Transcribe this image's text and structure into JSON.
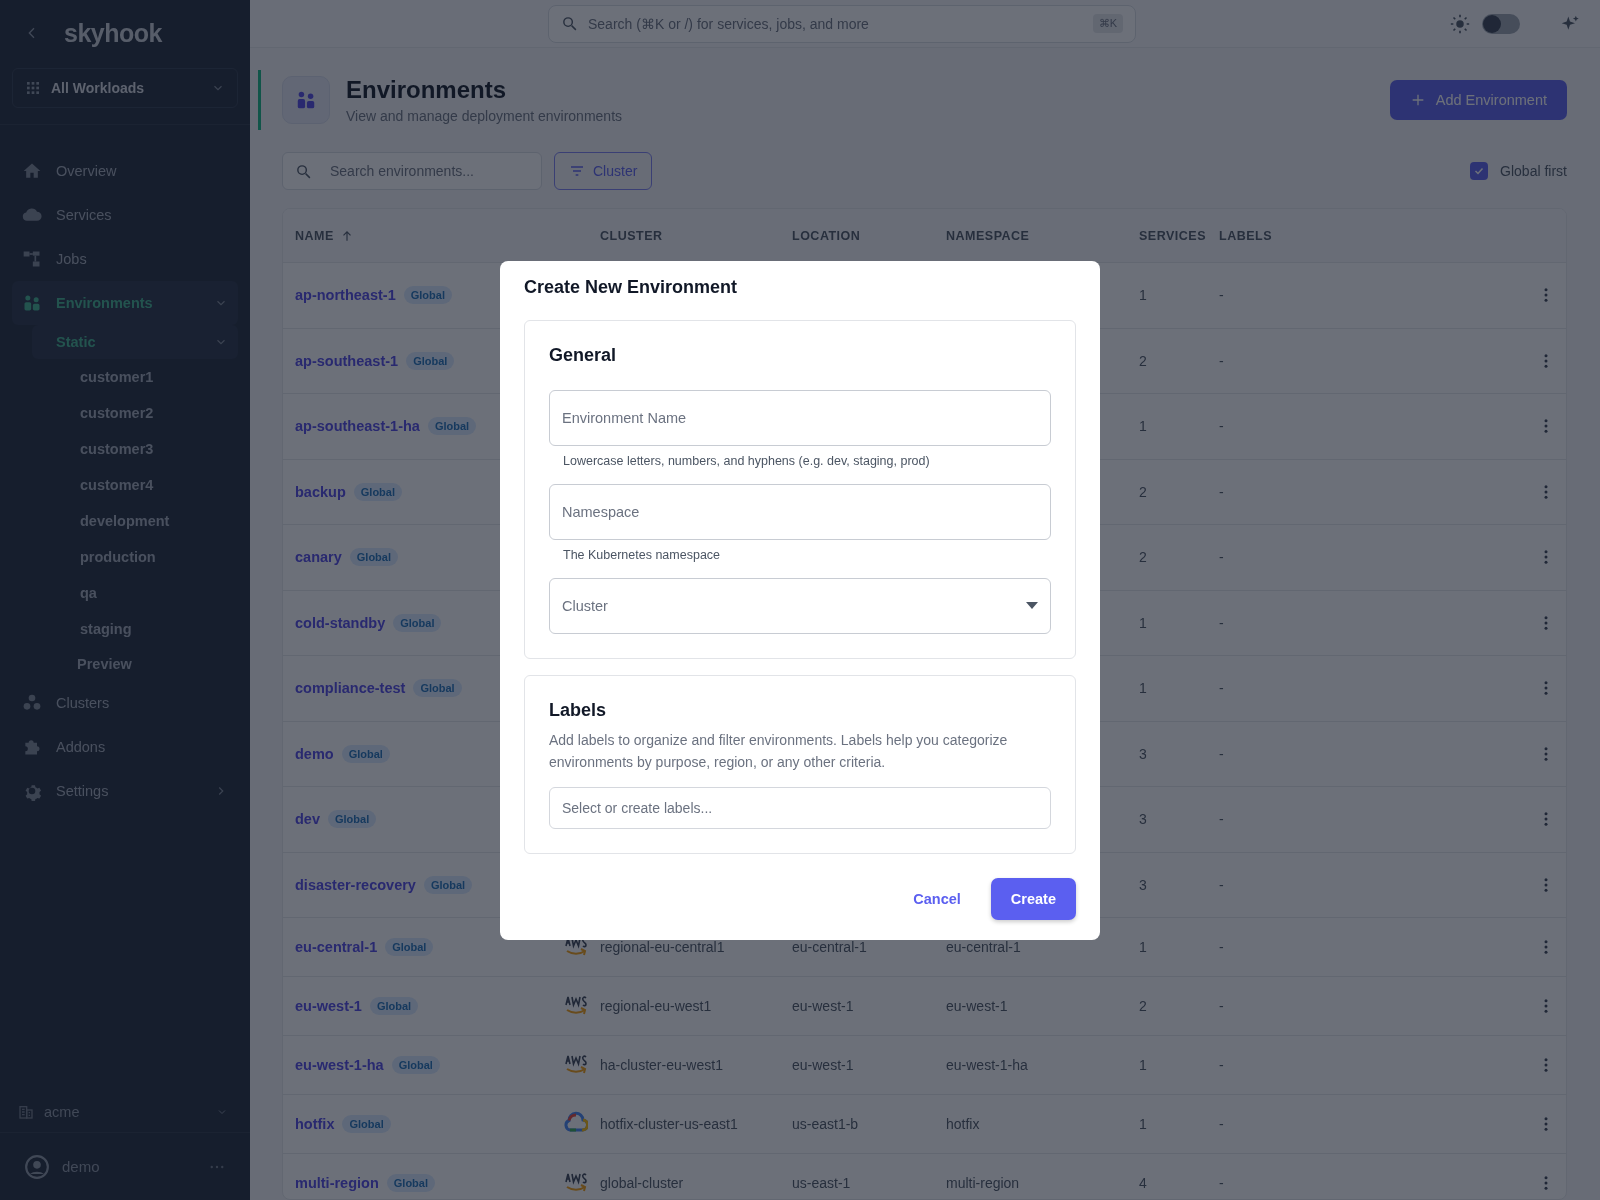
{
  "sidebar": {
    "logo": "skyhook",
    "workspace": "All Workloads",
    "nav": [
      {
        "label": "Overview",
        "kind": "link",
        "selected": false
      },
      {
        "label": "Services",
        "kind": "link",
        "selected": false
      },
      {
        "label": "Jobs",
        "kind": "link",
        "selected": false
      },
      {
        "label": "Environments",
        "kind": "group",
        "selected": true,
        "expanded": true,
        "children": [
          {
            "label": "Static",
            "kind": "group",
            "selected": true,
            "expanded": true,
            "children": [
              {
                "label": "customer1",
                "selected": false
              },
              {
                "label": "customer2",
                "selected": false
              },
              {
                "label": "customer3",
                "selected": false
              },
              {
                "label": "customer4",
                "selected": false
              },
              {
                "label": "development",
                "selected": false
              },
              {
                "label": "production",
                "selected": false
              },
              {
                "label": "qa",
                "selected": false
              },
              {
                "label": "staging",
                "selected": false
              }
            ]
          },
          {
            "label": "Preview",
            "kind": "link",
            "selected": false
          }
        ]
      },
      {
        "label": "Clusters",
        "kind": "link",
        "selected": false
      },
      {
        "label": "Addons",
        "kind": "link",
        "selected": false
      },
      {
        "label": "Settings",
        "kind": "group",
        "selected": false,
        "expanded": false
      }
    ],
    "org": "acme",
    "user": "demo"
  },
  "topbar": {
    "search": {
      "placeholder": "Search (⌘K or /) for services, jobs, and more",
      "shortcut": "⌘K"
    },
    "dark_mode": {
      "on": false
    }
  },
  "header": {
    "title": "Environments",
    "subtitle": "View and manage deployment environments",
    "add_button": "Add Environment"
  },
  "toolbar": {
    "search": {
      "placeholder": "Search environments..."
    },
    "filter_button": "Cluster",
    "global_first": {
      "label": "Global first",
      "checked": true
    }
  },
  "table": {
    "columns": [
      {
        "label": "NAME",
        "sorted": true
      },
      {
        "label": "CLUSTER",
        "sorted": false
      },
      {
        "label": "LOCATION",
        "sorted": false
      },
      {
        "label": "NAMESPACE",
        "sorted": false
      },
      {
        "label": "SERVICES",
        "sorted": false
      },
      {
        "label": "LABELS",
        "sorted": false
      }
    ],
    "rows": [
      {
        "name": "ap-northeast-1",
        "badge": "Global",
        "services": "1",
        "labels": "-"
      },
      {
        "name": "ap-southeast-1",
        "badge": "Global",
        "services": "2",
        "labels": "-"
      },
      {
        "name": "ap-southeast-1-ha",
        "badge": "Global",
        "services": "1",
        "labels": "-"
      },
      {
        "name": "backup",
        "badge": "Global",
        "services": "2",
        "labels": "-"
      },
      {
        "name": "canary",
        "badge": "Global",
        "services": "2",
        "labels": "-"
      },
      {
        "name": "cold-standby",
        "badge": "Global",
        "services": "1",
        "labels": "-"
      },
      {
        "name": "compliance-test",
        "badge": "Global",
        "services": "1",
        "labels": "-"
      },
      {
        "name": "demo",
        "badge": "Global",
        "services": "3",
        "labels": "-"
      },
      {
        "name": "dev",
        "badge": "Global",
        "services": "3",
        "labels": "-"
      },
      {
        "name": "disaster-recovery",
        "badge": "Global",
        "services": "3",
        "labels": "-"
      },
      {
        "name": "eu-central-1",
        "badge": "Global",
        "kind": "aws",
        "cluster": "regional-eu-central1",
        "location": "eu-central-1",
        "namespace": "eu-central-1",
        "services": "1",
        "labels": "-"
      },
      {
        "name": "eu-west-1",
        "badge": "Global",
        "kind": "aws",
        "cluster": "regional-eu-west1",
        "location": "eu-west-1",
        "namespace": "eu-west-1",
        "services": "2",
        "labels": "-"
      },
      {
        "name": "eu-west-1-ha",
        "badge": "Global",
        "kind": "aws",
        "cluster": "ha-cluster-eu-west1",
        "location": "eu-west-1",
        "namespace": "eu-west-1-ha",
        "services": "1",
        "labels": "-"
      },
      {
        "name": "hotfix",
        "badge": "Global",
        "kind": "gcp",
        "cluster": "hotfix-cluster-us-east1",
        "location": "us-east1-b",
        "namespace": "hotfix",
        "services": "1",
        "labels": "-"
      },
      {
        "name": "multi-region",
        "badge": "Global",
        "kind": "aws",
        "cluster": "global-cluster",
        "location": "us-east-1",
        "namespace": "multi-region",
        "services": "4",
        "labels": "-"
      }
    ]
  },
  "dialog": {
    "title": "Create New Environment",
    "general": {
      "heading": "General",
      "fields": [
        {
          "kind": "text",
          "placeholder": "Environment Name",
          "helper": "Lowercase letters, numbers, and hyphens (e.g. dev, staging, prod)"
        },
        {
          "kind": "text",
          "placeholder": "Namespace",
          "helper": "The Kubernetes namespace"
        },
        {
          "kind": "select",
          "placeholder": "Cluster"
        }
      ]
    },
    "labels": {
      "heading": "Labels",
      "description": "Add labels to organize and filter environments. Labels help you categorize environments by purpose, region, or any other criteria.",
      "placeholder": "Select or create labels..."
    },
    "buttons": [
      {
        "label": "Cancel",
        "kind": "text"
      },
      {
        "label": "Create",
        "kind": "primary"
      }
    ]
  }
}
